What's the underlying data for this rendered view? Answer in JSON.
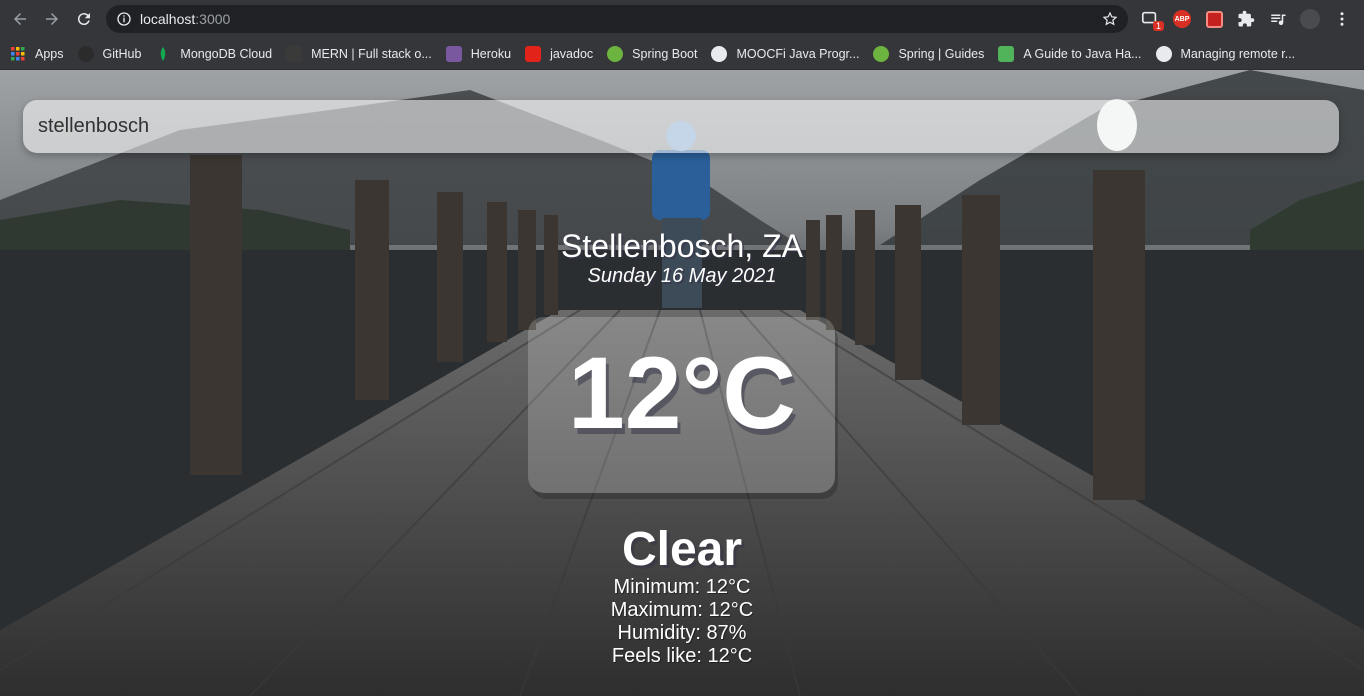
{
  "browser": {
    "url_host": "localhost",
    "url_port": ":3000",
    "extensions": [
      {
        "icon": "screen-share-icon",
        "badge": "1"
      },
      {
        "icon": "adblock-icon",
        "label": "ABP"
      },
      {
        "icon": "extension-red-icon"
      },
      {
        "icon": "puzzle-icon"
      },
      {
        "icon": "media-queue-icon"
      },
      {
        "icon": "profile-avatar-icon"
      },
      {
        "icon": "more-vert-icon"
      }
    ]
  },
  "bookmarks": [
    {
      "label": "Apps",
      "icon": "apps-grid-icon",
      "color": "#ea4335"
    },
    {
      "label": "GitHub",
      "icon": "github-icon",
      "color": "#2b2b2b"
    },
    {
      "label": "MongoDB Cloud",
      "icon": "mongodb-leaf-icon",
      "color": "#13aa52"
    },
    {
      "label": "MERN | Full stack o...",
      "icon": "page-icon",
      "color": "#3a3a3a"
    },
    {
      "label": "Heroku",
      "icon": "heroku-icon",
      "color": "#79589f"
    },
    {
      "label": "javadoc",
      "icon": "oracle-icon",
      "color": "#e2231a"
    },
    {
      "label": "Spring Boot",
      "icon": "spring-icon",
      "color": "#6db33f"
    },
    {
      "label": "MOOCFi Java Progr...",
      "icon": "globe-icon",
      "color": "#e8eaed"
    },
    {
      "label": "Spring | Guides",
      "icon": "spring-icon",
      "color": "#6db33f"
    },
    {
      "label": "A Guide to Java Ha...",
      "icon": "leaf-square-icon",
      "color": "#52b45a"
    },
    {
      "label": "Managing remote r...",
      "icon": "github-icon",
      "color": "#e8eaed"
    }
  ],
  "search": {
    "value": "stellenbosch"
  },
  "weather": {
    "location": "Stellenbosch, ZA",
    "date": "Sunday 16 May 2021",
    "temperature": "12°C",
    "condition": "Clear",
    "details": [
      "Minimum: 12°C",
      "Maximum: 12°C",
      "Humidity: 87%",
      "Feels like: 12°C"
    ]
  }
}
